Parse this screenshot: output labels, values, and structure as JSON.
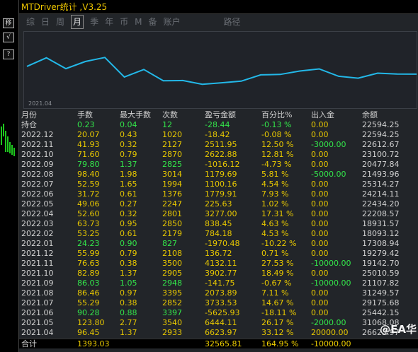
{
  "window": {
    "title": "MTDriver统计 ,V3.25"
  },
  "left_buttons": [
    "移",
    "√",
    "?"
  ],
  "tabs": [
    "综",
    "日",
    "周",
    "月",
    "季",
    "年",
    "币",
    "M",
    "备",
    "账户",
    "路径"
  ],
  "active_tab": "月",
  "chart": {
    "date_label": "2021.04",
    "line_color": "#23b8e8"
  },
  "table": {
    "headers": [
      "月份",
      "手数",
      "最大手数",
      "次数",
      "盈亏金额",
      "百分比%",
      "出入金",
      "余额"
    ],
    "rows": [
      [
        "持仓",
        "0.23",
        "0.04",
        "12",
        "-28.44",
        "-0.13 %",
        "0.00",
        "22594.25"
      ],
      [
        "2022.12",
        "20.07",
        "0.43",
        "1020",
        "-18.42",
        "-0.08 %",
        "0.00",
        "22594.25"
      ],
      [
        "2022.11",
        "41.93",
        "0.32",
        "2127",
        "2511.95",
        "12.50 %",
        "-3000.00",
        "22612.67"
      ],
      [
        "2022.10",
        "71.60",
        "0.79",
        "2870",
        "2622.88",
        "12.81 %",
        "0.00",
        "23100.72"
      ],
      [
        "2022.09",
        "79.80",
        "1.37",
        "2825",
        "-1016.12",
        "-4.73 %",
        "0.00",
        "20477.84"
      ],
      [
        "2022.08",
        "98.40",
        "1.98",
        "3014",
        "1179.69",
        "5.81 %",
        "-5000.00",
        "21493.96"
      ],
      [
        "2022.07",
        "52.59",
        "1.65",
        "1994",
        "1100.16",
        "4.54 %",
        "0.00",
        "25314.27"
      ],
      [
        "2022.06",
        "31.72",
        "0.61",
        "1376",
        "1779.91",
        "7.93 %",
        "0.00",
        "24214.11"
      ],
      [
        "2022.05",
        "49.06",
        "0.27",
        "2247",
        "225.63",
        "1.02 %",
        "0.00",
        "22434.20"
      ],
      [
        "2022.04",
        "52.60",
        "0.32",
        "2801",
        "3277.00",
        "17.31 %",
        "0.00",
        "22208.57"
      ],
      [
        "2022.03",
        "63.73",
        "0.95",
        "2850",
        "838.45",
        "4.63 %",
        "0.00",
        "18931.57"
      ],
      [
        "2022.02",
        "53.25",
        "0.61",
        "2179",
        "784.18",
        "4.53 %",
        "0.00",
        "18093.12"
      ],
      [
        "2022.01",
        "24.23",
        "0.90",
        "827",
        "-1970.48",
        "-10.22 %",
        "0.00",
        "17308.94"
      ],
      [
        "2021.12",
        "55.99",
        "0.79",
        "2108",
        "136.72",
        "0.71 %",
        "0.00",
        "19279.42"
      ],
      [
        "2021.11",
        "76.63",
        "0.38",
        "3500",
        "4132.11",
        "27.53 %",
        "-10000.00",
        "19142.70"
      ],
      [
        "2021.10",
        "82.89",
        "1.37",
        "2905",
        "3902.77",
        "18.49 %",
        "0.00",
        "25010.59"
      ],
      [
        "2021.09",
        "86.03",
        "1.05",
        "2948",
        "-141.75",
        "-0.67 %",
        "-10000.00",
        "21107.82"
      ],
      [
        "2021.08",
        "86.46",
        "0.97",
        "3395",
        "2073.89",
        "7.11 %",
        "0.00",
        "31249.57"
      ],
      [
        "2021.07",
        "55.29",
        "0.38",
        "2852",
        "3733.53",
        "14.67 %",
        "0.00",
        "29175.68"
      ],
      [
        "2021.06",
        "90.28",
        "0.88",
        "3397",
        "-5625.93",
        "-18.11 %",
        "0.00",
        "25442.15"
      ],
      [
        "2021.05",
        "123.80",
        "2.77",
        "3540",
        "6444.11",
        "26.17 %",
        "-2000.00",
        "31068.08"
      ],
      [
        "2021.04",
        "96.45",
        "1.37",
        "2933",
        "6623.97",
        "33.12 %",
        "20000.00",
        "26623.97"
      ]
    ],
    "total": [
      "合计",
      "1393.03",
      "",
      "",
      "32565.81",
      "164.95 %",
      "-10000.00",
      ""
    ]
  },
  "watermark": "@EA华"
}
